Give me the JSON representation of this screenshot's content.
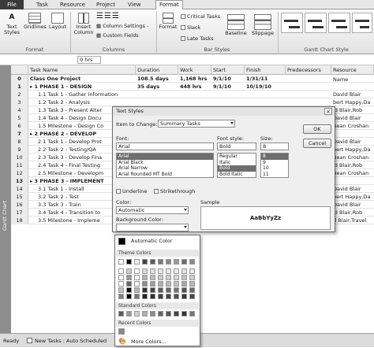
{
  "ribbon_tabs": [
    "File",
    "Task",
    "Resource",
    "Project",
    "View",
    "Format"
  ],
  "ribbon": {
    "text_styles": "Text Styles",
    "gridlines": "Gridlines",
    "layout": "Layout",
    "insert_column": "Insert Column",
    "column_settings": "Column Settings -",
    "custom_fields": "Custom Fields",
    "format_btn": "Format",
    "critical": "Critical Tasks",
    "slack": "Slack",
    "late": "Late Tasks",
    "baseline": "Baseline",
    "slippage": "Slippage",
    "groups": [
      "Format",
      "Columns",
      "Bar Styles",
      "Gantt Chart Style"
    ]
  },
  "timescale_value": "0 hrs",
  "sidebar_label": "Gantt Chart",
  "columns": [
    "Task Name",
    "Duration",
    "Work",
    "Start",
    "Finish",
    "Predecessors",
    "Resource Name"
  ],
  "rows": [
    {
      "n": "0",
      "name": "Class One Project",
      "dur": "108.5 days",
      "work": "1,168 hrs",
      "start": "9/1/10",
      "finish": "1/31/11",
      "res": "",
      "b": true
    },
    {
      "n": "1",
      "name": "▸ 1 PHASE 1 · DESIGN",
      "dur": "35 days",
      "work": "448 hrs",
      "start": "9/1/10",
      "finish": "10/19/10",
      "res": "",
      "b": true
    },
    {
      "n": "2",
      "name": "1.1 Task 1 - Gather Information",
      "dur": "",
      "work": "",
      "start": "",
      "finish": "",
      "res": "David Blair",
      "b": false
    },
    {
      "n": "3",
      "name": "1.2 Task 2 - Analysis",
      "dur": "",
      "work": "",
      "start": "",
      "finish": "",
      "res": "bert Happy,Da",
      "b": false
    },
    {
      "n": "4",
      "name": "1.3 Task 3 - Present Alter",
      "dur": "",
      "work": "",
      "start": "",
      "finish": "",
      "res": "id Blair,Rob",
      "b": false
    },
    {
      "n": "5",
      "name": "1.4 Task 4 - Design Docu",
      "dur": "",
      "work": "",
      "start": "",
      "finish": "",
      "res": "David Blair",
      "b": false
    },
    {
      "n": "6",
      "name": "1.5 Milestone - Design Co",
      "dur": "",
      "work": "",
      "start": "",
      "finish": "",
      "res": "Bean Croshan",
      "b": false
    },
    {
      "n": "7",
      "name": "▸ 2 PHASE 2 - DEVELOP",
      "dur": "",
      "work": "",
      "start": "",
      "finish": "",
      "res": "",
      "b": true
    },
    {
      "n": "8",
      "name": "2.1 Task 1 - Develop Prot",
      "dur": "",
      "work": "",
      "start": "",
      "finish": "",
      "res": "David Blair",
      "b": false
    },
    {
      "n": "9",
      "name": "2.2 Task 2 - Testing/QA",
      "dur": "",
      "work": "",
      "start": "",
      "finish": "",
      "res": "bert Happy,Da",
      "b": false
    },
    {
      "n": "10",
      "name": "2.3 Task 3 - Develop Fina",
      "dur": "",
      "work": "",
      "start": "",
      "finish": "",
      "res": "Bean Croshan",
      "b": false
    },
    {
      "n": "11",
      "name": "2.4 Task 4 - Final Testing",
      "dur": "",
      "work": "",
      "start": "",
      "finish": "",
      "res": "id Blair,Rob",
      "b": false
    },
    {
      "n": "12",
      "name": "2.5 Milestone - Developm",
      "dur": "",
      "work": "",
      "start": "",
      "finish": "",
      "res": "Bean Croshan",
      "b": false
    },
    {
      "n": "13",
      "name": "▸ 3 PHASE 3 - IMPLEMENT",
      "dur": "",
      "work": "",
      "start": "",
      "finish": "",
      "res": "",
      "b": true
    },
    {
      "n": "14",
      "name": "3.1 Task 1 - Install",
      "dur": "",
      "work": "",
      "start": "",
      "finish": "",
      "res": "David Blair",
      "b": false
    },
    {
      "n": "15",
      "name": "3.2 Task 2 - Test",
      "dur": "",
      "work": "",
      "start": "",
      "finish": "",
      "res": "bert Happy,Da",
      "b": false
    },
    {
      "n": "16",
      "name": "3.3 Task 3 - Train",
      "dur": "",
      "work": "",
      "start": "",
      "finish": "",
      "res": "David Blair",
      "b": false
    },
    {
      "n": "17",
      "name": "3.4 Task 4 - Transition to",
      "dur": "",
      "work": "",
      "start": "",
      "finish": "",
      "res": "id Blair,Rob",
      "b": false
    },
    {
      "n": "18",
      "name": "3.5 Milestone - Impleme",
      "dur": "",
      "work": "",
      "start": "",
      "finish": "",
      "res": "d Blair,Travel",
      "b": false
    }
  ],
  "dialog": {
    "title": "Text Styles",
    "item_label": "Item to Change:",
    "item_value": "Summary Tasks",
    "font_label": "Font:",
    "font_value": "Arial",
    "fonts": [
      "Arial",
      "Arial Black",
      "Arial Narrow",
      "Arial Rounded MT Bold"
    ],
    "style_label": "Font style:",
    "style_value": "Bold",
    "styles": [
      "Regular",
      "Italic",
      "Bold",
      "Bold Italic"
    ],
    "size_label": "Size:",
    "size_value": "8",
    "sizes": [
      "8",
      "9",
      "10",
      "11"
    ],
    "underline": "Underline",
    "strikethrough": "Strikethrough",
    "color_label": "Color:",
    "color_value": "Automatic",
    "bg_label": "Background Color:",
    "sample_label": "Sample",
    "sample_text": "AaBbYyZz",
    "ok": "OK",
    "cancel": "Cancel"
  },
  "palette": {
    "automatic": "Automatic Color",
    "theme": "Theme Colors",
    "standard": "Standard Colors",
    "recent": "Recent Colors",
    "more": "More Colors...",
    "theme_colors": [
      "#ffffff",
      "#000000",
      "#eeeeee",
      "#404040",
      "#5a5a5a",
      "#7a7a7a",
      "#888888",
      "#9a9a9a",
      "#6a6a6a",
      "#8a8a8a"
    ],
    "standard_colors": [
      "#5a5a5a",
      "#999999",
      "#d0d0d0",
      "#b0b0b0",
      "#8a8a8a",
      "#666666",
      "#555555",
      "#444444",
      "#333333",
      "#777777"
    ]
  },
  "status_text": "New Tasks : Auto Scheduled",
  "status_left": "Ready"
}
